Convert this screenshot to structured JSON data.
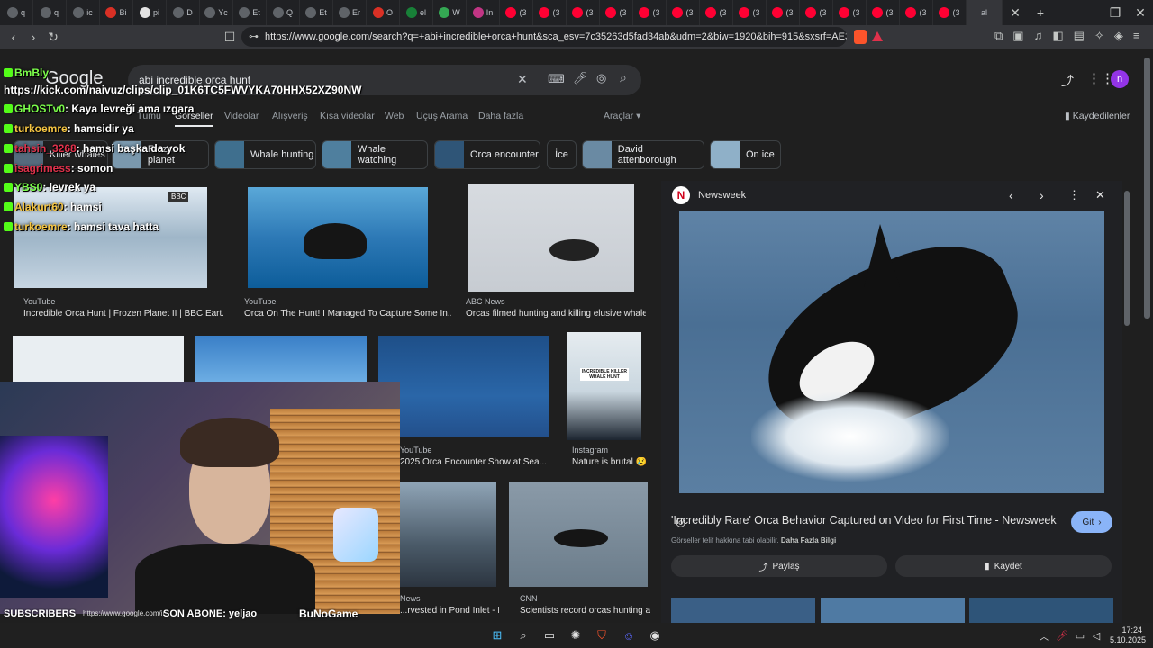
{
  "tabs": [
    {
      "label": "q",
      "color": "#5f6368"
    },
    {
      "label": "q",
      "color": "#5f6368"
    },
    {
      "label": "ic",
      "color": "#5f6368"
    },
    {
      "label": "Bi",
      "color": "#d93025"
    },
    {
      "label": "pi",
      "color": "#e3e3e3"
    },
    {
      "label": "D",
      "color": "#5f6368"
    },
    {
      "label": "Yc",
      "color": "#5f6368"
    },
    {
      "label": "Et",
      "color": "#5f6368"
    },
    {
      "label": "Q",
      "color": "#5f6368"
    },
    {
      "label": "Et",
      "color": "#5f6368"
    },
    {
      "label": "Er",
      "color": "#5f6368"
    },
    {
      "label": "O",
      "color": "#d93025"
    },
    {
      "label": "el",
      "color": "#188038"
    },
    {
      "label": "W",
      "color": "#34a853"
    },
    {
      "label": "In",
      "color": "#c13584"
    },
    {
      "label": "(3",
      "color": "#ff0033"
    },
    {
      "label": "(3",
      "color": "#ff0033"
    },
    {
      "label": "(3",
      "color": "#ff0033"
    },
    {
      "label": "(3",
      "color": "#ff0033"
    },
    {
      "label": "(3",
      "color": "#ff0033"
    },
    {
      "label": "(3",
      "color": "#ff0033"
    },
    {
      "label": "(3",
      "color": "#ff0033"
    },
    {
      "label": "(3",
      "color": "#ff0033"
    },
    {
      "label": "(3",
      "color": "#ff0033"
    },
    {
      "label": "(3",
      "color": "#ff0033"
    },
    {
      "label": "(3",
      "color": "#ff0033"
    },
    {
      "label": "(3",
      "color": "#ff0033"
    },
    {
      "label": "(3",
      "color": "#ff0033"
    },
    {
      "label": "(3",
      "color": "#ff0033"
    }
  ],
  "active_tab": {
    "label": "al"
  },
  "address": {
    "url": "https://www.google.com/search?q=+abi+incredible+orca+hunt&sca_esv=7c35263d5fad34ab&udm=2&biw=1920&bih=915&sxsrf=AE3TifMK68pArh_Zl..."
  },
  "search": {
    "query": "abi incredible orca hunt",
    "logo": "Google",
    "avatar_letter": "n"
  },
  "navtabs": [
    "Tümü",
    "Görseller",
    "Videolar",
    "Alışveriş",
    "Kısa videolar",
    "Web",
    "Uçuş Arama",
    "Daha fazla"
  ],
  "tools_label": "Araçlar",
  "saved_label": "Kaydedilenler",
  "chips": [
    {
      "label": "Killer whales"
    },
    {
      "label": "Frozen planet"
    },
    {
      "label": "Whale hunting"
    },
    {
      "label": "Whale watching"
    },
    {
      "label": "Orca encounter"
    },
    {
      "label": "İce"
    },
    {
      "label": "David attenborough"
    },
    {
      "label": "On ice"
    }
  ],
  "results_row1": [
    {
      "source": "YouTube",
      "title": "Incredible Orca Hunt | Frozen Planet II | BBC Eart..."
    },
    {
      "source": "YouTube",
      "title": "Orca On The Hunt! I Managed To Capture Some In..."
    },
    {
      "source": "ABC News",
      "title": "Orcas filmed hunting and killing elusive whale ..."
    }
  ],
  "results_row2": [
    {
      "source": "YouTube",
      "title": "2025 Orca Encounter Show at Sea..."
    },
    {
      "source": "Instagram",
      "title": "Nature is brutal 😢",
      "thumb_text": "INCREDIBLE KILLER WHALE HUNT"
    }
  ],
  "results_row3": [
    {
      "source": "News",
      "title": "...rvested in Pond Inlet - N..."
    },
    {
      "source": "CNN",
      "title": "Scientists record orcas hunting a..."
    }
  ],
  "panel": {
    "source": "Newsweek",
    "title": "'Incredibly Rare' Orca Behavior Captured on Video for First Time - Newsweek",
    "go_label": "Git",
    "copyright": "Görseller telif hakkına tabi olabilir.",
    "more_info": "Daha Fazla Bilgi",
    "share_label": "Paylaş",
    "save_label": "Kaydet"
  },
  "chat": [
    {
      "user": "BmBly",
      "msg": "",
      "color": "#7cff4b"
    },
    {
      "user": "",
      "msg": "https://kick.com/naivuz/clips/clip_01K6TC5FWVYKA70HHX52XZ90NW",
      "color": "#ffffff"
    },
    {
      "user": "GHOSTv0",
      "msg": ": Kaya levreği ama ızgara",
      "color": "#7cff4b"
    },
    {
      "user": "turkoemre",
      "msg": ": hamsidir ya",
      "color": "#f5c542"
    },
    {
      "user": "tahsin_3268",
      "msg": ": hamsi başka da yok",
      "color": "#e0314b"
    },
    {
      "user": "isagrimess",
      "msg": ": somon",
      "color": "#e0314b"
    },
    {
      "user": "YBS0",
      "msg": ": levrek ya",
      "color": "#7cff4b"
    },
    {
      "user": "Alakurt60",
      "msg": ": hamsi",
      "color": "#f5c542"
    },
    {
      "user": "turkoemre",
      "msg": ": hamsi tava hatta",
      "color": "#f5c542"
    }
  ],
  "stream_bar": {
    "subscribers_label": "SUBSCRIBERS",
    "son_abone": "SON ABONE: yeljao",
    "status_url": "https://www.google.com/imgres?q= abi incredible...",
    "brand": "BuNoGame"
  },
  "clock": {
    "time": "17:24",
    "date": "5.10.2025"
  },
  "colors": {
    "accent": "#8ab4f8",
    "avatar": "#9334e6",
    "go_button": "#8ab4f8"
  }
}
